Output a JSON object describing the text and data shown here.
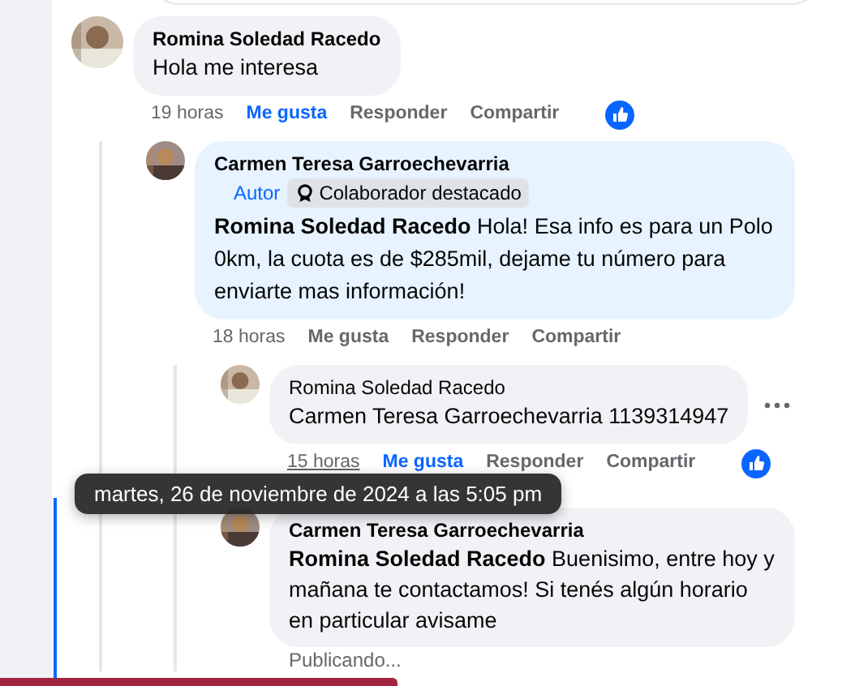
{
  "comments": [
    {
      "author": "Romina Soledad Racedo",
      "text": "Hola me interesa",
      "time": "19 horas",
      "like": "Me gusta",
      "liked": true,
      "reply": "Responder",
      "share": "Compartir",
      "reaction": true,
      "children": [
        {
          "author": "Carmen Teresa Garroechevarria",
          "tinted": true,
          "badges": [
            {
              "kind": "author",
              "label": "Autor"
            },
            {
              "kind": "contributor",
              "label": "Colaborador destacado"
            }
          ],
          "text": "**Romina Soledad Racedo** Hola! Esa info es para un Polo 0km, la cuota es de $285mil, dejame tu número para enviarte mas información!",
          "time": "18 horas",
          "like": "Me gusta",
          "liked": false,
          "reply": "Responder",
          "share": "Compartir",
          "reaction": false,
          "children": [
            {
              "author": "Romina Soledad Racedo",
              "text": "Carmen Teresa Garroechevarria 1139314947",
              "time": "15 horas",
              "time_hovered": true,
              "like": "Me gusta",
              "liked": true,
              "reply": "Responder",
              "share": "Compartir",
              "reaction": true,
              "menu": true
            },
            {
              "author": "Carmen Teresa Garroechevarria",
              "focused": true,
              "text": "**Romina Soledad Racedo** Buenisimo, entre hoy y mañana te contactamos! Si tenés algún horario en particular avisame",
              "status": "Publicando..."
            }
          ]
        }
      ]
    }
  ],
  "tooltip": "martes, 26 de noviembre de 2024 a las 5:05 pm"
}
